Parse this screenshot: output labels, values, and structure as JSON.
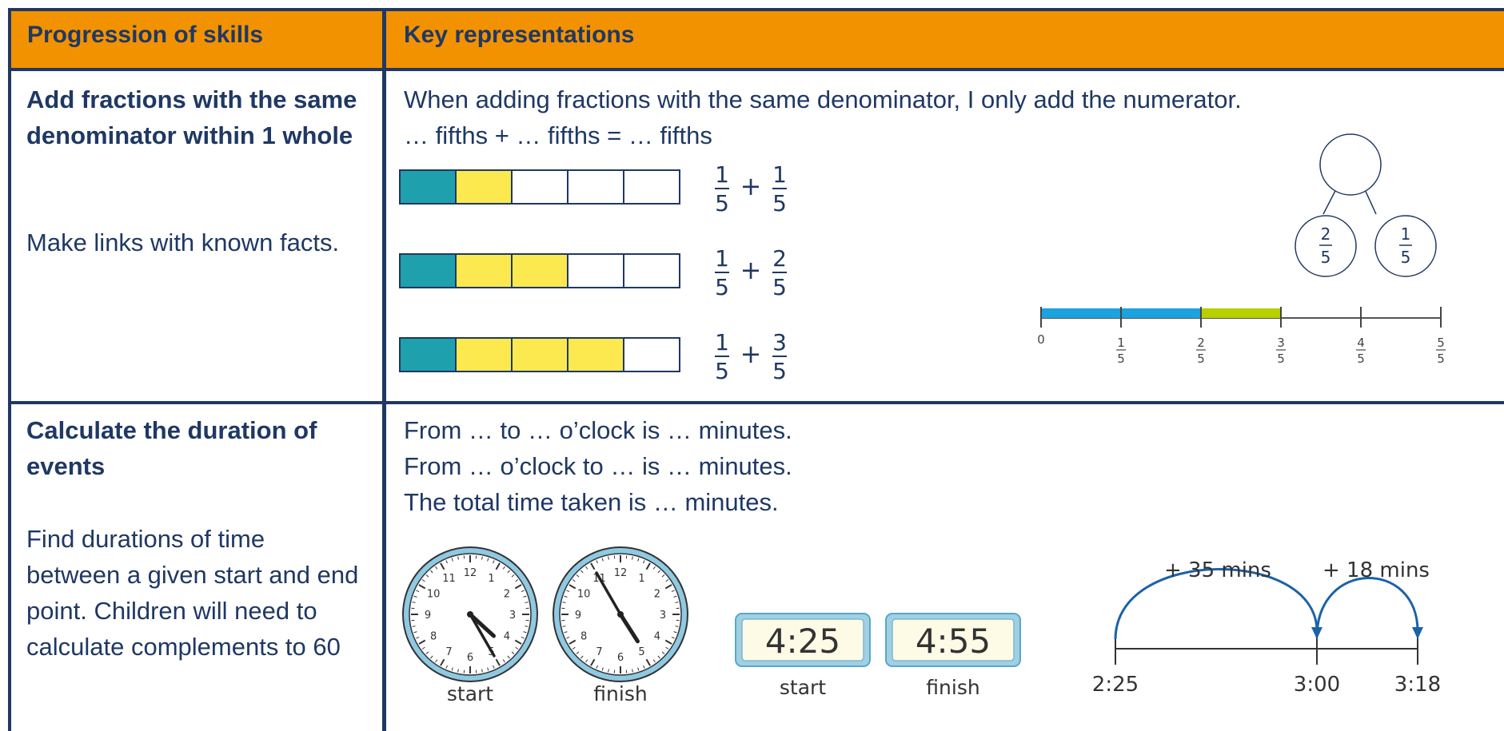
{
  "header": {
    "col1": "Progression of skills",
    "col2": "Key representations"
  },
  "row1": {
    "skill_title": "Add fractions with the same denominator within 1 whole",
    "skill_note": "Make links with known facts.",
    "line1": "When adding fractions with the same denominator, I only add the numerator.",
    "line2": "… fifths + … fifths = … fifths",
    "bar_models": [
      {
        "teal": 1,
        "yellow": 1,
        "total": 5,
        "a": "1",
        "b": "1",
        "den": "5"
      },
      {
        "teal": 1,
        "yellow": 2,
        "total": 5,
        "a": "1",
        "b": "2",
        "den": "5"
      },
      {
        "teal": 1,
        "yellow": 3,
        "total": 5,
        "a": "1",
        "b": "3",
        "den": "5"
      }
    ],
    "part_whole": {
      "left_num": "2",
      "right_num": "1",
      "den": "5"
    },
    "number_line": {
      "ticks": [
        "0",
        "1/5",
        "2/5",
        "3/5",
        "4/5",
        "5/5"
      ],
      "blue_end": 2,
      "green_end": 3,
      "colors": {
        "blue": "#1ba3dd",
        "green": "#b8cf00"
      }
    },
    "colors": {
      "teal": "#1fa0ad",
      "yellow": "#fce94f"
    }
  },
  "row2": {
    "skill_title": "Calculate the duration of events",
    "skill_note": "Find durations of time between a given start and end point. Children will need to calculate complements to 60",
    "lines": [
      "From … to … o’clock is … minutes.",
      "From … o’clock to … is … minutes.",
      "The total time taken is … minutes."
    ],
    "analog_clocks": [
      {
        "label": "start",
        "hours": 4,
        "minutes": 25
      },
      {
        "label": "finish",
        "hours": 4,
        "minutes": 55
      }
    ],
    "digital_clocks": [
      {
        "label": "start",
        "time": "4:25"
      },
      {
        "label": "finish",
        "time": "4:55"
      }
    ],
    "timeline": {
      "points": [
        "2:25",
        "3:00",
        "3:18"
      ],
      "jumps": [
        "+ 35 mins",
        "+ 18 mins"
      ]
    }
  },
  "colors": {
    "header": "#f39200",
    "border": "#1f3864",
    "text": "#1f3864"
  }
}
